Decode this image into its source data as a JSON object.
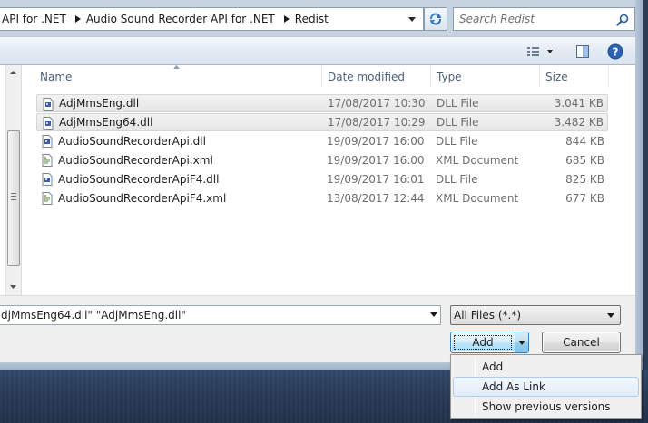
{
  "address": {
    "crumbs": [
      "API for .NET",
      "Audio Sound Recorder API for .NET",
      "Redist"
    ]
  },
  "search": {
    "placeholder": "Search Redist"
  },
  "toolbar": {
    "views_icon": "views-icon",
    "preview_icon": "preview-pane-icon",
    "help_icon": "help-icon"
  },
  "columns": {
    "name": "Name",
    "date": "Date modified",
    "type": "Type",
    "size": "Size"
  },
  "files": [
    {
      "name": "AdjMmsEng.dll",
      "date": "17/08/2017 10:30",
      "type": "DLL File",
      "size": "3.041 KB",
      "icon": "dll-file-icon",
      "selected": true
    },
    {
      "name": "AdjMmsEng64.dll",
      "date": "17/08/2017 10:29",
      "type": "DLL File",
      "size": "3.482 KB",
      "icon": "dll-file-icon",
      "selected": true
    },
    {
      "name": "AudioSoundRecorderApi.dll",
      "date": "19/09/2017 16:00",
      "type": "DLL File",
      "size": "844 KB",
      "icon": "dll-file-icon",
      "selected": false
    },
    {
      "name": "AudioSoundRecorderApi.xml",
      "date": "19/09/2017 16:00",
      "type": "XML Document",
      "size": "685 KB",
      "icon": "xml-file-icon",
      "selected": false
    },
    {
      "name": "AudioSoundRecorderApiF4.dll",
      "date": "19/09/2017 16:01",
      "type": "DLL File",
      "size": "825 KB",
      "icon": "dll-file-icon",
      "selected": false
    },
    {
      "name": "AudioSoundRecorderApiF4.xml",
      "date": "13/08/2017 12:44",
      "type": "XML Document",
      "size": "677 KB",
      "icon": "xml-file-icon",
      "selected": false
    }
  ],
  "filename": {
    "value": "djMmsEng64.dll\" \"AdjMmsEng.dll\""
  },
  "filter": {
    "selected": "All Files (*.*)"
  },
  "buttons": {
    "add": "Add",
    "cancel": "Cancel"
  },
  "menu": {
    "items": [
      "Add",
      "Add As Link",
      "Show previous versions"
    ],
    "highlighted_index": 1
  },
  "colors": {
    "accent_border": "#3c7fb1",
    "selection_bg": "#e6e6e6",
    "header_text": "#4c607a"
  }
}
